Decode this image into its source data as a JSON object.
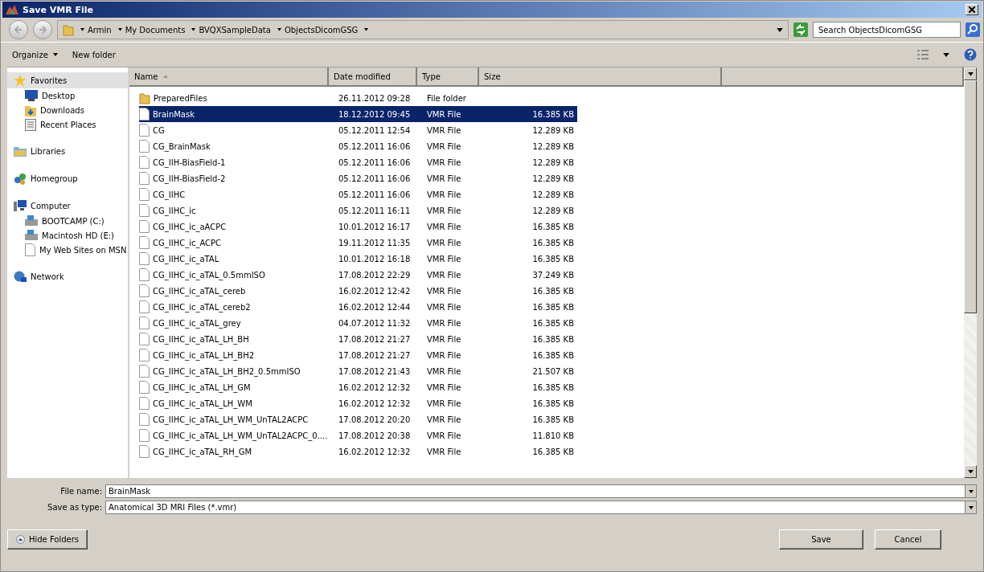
{
  "window": {
    "title": "Save VMR File"
  },
  "address": {
    "crumbs": [
      "Armin",
      "My Documents",
      "BVQXSampleData",
      "ObjectsDicomGSG"
    ],
    "search_placeholder": "Search ObjectsDicomGSG"
  },
  "toolbar": {
    "organize": "Organize",
    "new_folder": "New folder"
  },
  "sidebar": [
    {
      "label": "Favorites",
      "kind": "star",
      "selected": true,
      "children": [
        {
          "label": "Desktop",
          "kind": "desktop",
          "selected": false
        },
        {
          "label": "Downloads",
          "kind": "downloads",
          "selected": false
        },
        {
          "label": "Recent Places",
          "kind": "recent",
          "selected": false
        }
      ]
    },
    {
      "label": "Libraries",
      "kind": "library",
      "selected": false
    },
    {
      "label": "Homegroup",
      "kind": "homegroup",
      "selected": false
    },
    {
      "label": "Computer",
      "kind": "computer",
      "selected": false,
      "children": [
        {
          "label": "BOOTCAMP (C:)",
          "kind": "drive",
          "selected": false
        },
        {
          "label": "Macintosh HD (E:)",
          "kind": "drive",
          "selected": false
        },
        {
          "label": "My Web Sites on MSN",
          "kind": "file",
          "selected": false
        }
      ]
    },
    {
      "label": "Network",
      "kind": "network",
      "selected": false
    }
  ],
  "table": {
    "columns": [
      "Name",
      "Date modified",
      "Type",
      "Size"
    ],
    "rows": [
      {
        "name": "PreparedFiles",
        "date": "26.11.2012 09:28",
        "type": "File folder",
        "size": "",
        "kind": "folder",
        "selected": false
      },
      {
        "name": "BrainMask",
        "date": "18.12.2012 09:45",
        "type": "VMR File",
        "size": "16.385 KB",
        "kind": "file",
        "selected": true
      },
      {
        "name": "CG",
        "date": "05.12.2011 12:54",
        "type": "VMR File",
        "size": "12.289 KB",
        "kind": "file",
        "selected": false
      },
      {
        "name": "CG_BrainMask",
        "date": "05.12.2011 16:06",
        "type": "VMR File",
        "size": "12.289 KB",
        "kind": "file",
        "selected": false
      },
      {
        "name": "CG_IIH-BiasField-1",
        "date": "05.12.2011 16:06",
        "type": "VMR File",
        "size": "12.289 KB",
        "kind": "file",
        "selected": false
      },
      {
        "name": "CG_IIH-BiasField-2",
        "date": "05.12.2011 16:06",
        "type": "VMR File",
        "size": "12.289 KB",
        "kind": "file",
        "selected": false
      },
      {
        "name": "CG_IIHC",
        "date": "05.12.2011 16:06",
        "type": "VMR File",
        "size": "12.289 KB",
        "kind": "file",
        "selected": false
      },
      {
        "name": "CG_IIHC_ic",
        "date": "05.12.2011 16:11",
        "type": "VMR File",
        "size": "12.289 KB",
        "kind": "file",
        "selected": false
      },
      {
        "name": "CG_IIHC_ic_aACPC",
        "date": "10.01.2012 16:17",
        "type": "VMR File",
        "size": "16.385 KB",
        "kind": "file",
        "selected": false
      },
      {
        "name": "CG_IIHC_ic_ACPC",
        "date": "19.11.2012 11:35",
        "type": "VMR File",
        "size": "16.385 KB",
        "kind": "file",
        "selected": false
      },
      {
        "name": "CG_IIHC_ic_aTAL",
        "date": "10.01.2012 16:18",
        "type": "VMR File",
        "size": "16.385 KB",
        "kind": "file",
        "selected": false
      },
      {
        "name": "CG_IIHC_ic_aTAL_0.5mmISO",
        "date": "17.08.2012 22:29",
        "type": "VMR File",
        "size": "37.249 KB",
        "kind": "file",
        "selected": false
      },
      {
        "name": "CG_IIHC_ic_aTAL_cereb",
        "date": "16.02.2012 12:42",
        "type": "VMR File",
        "size": "16.385 KB",
        "kind": "file",
        "selected": false
      },
      {
        "name": "CG_IIHC_ic_aTAL_cereb2",
        "date": "16.02.2012 12:44",
        "type": "VMR File",
        "size": "16.385 KB",
        "kind": "file",
        "selected": false
      },
      {
        "name": "CG_IIHC_ic_aTAL_grey",
        "date": "04.07.2012 11:32",
        "type": "VMR File",
        "size": "16.385 KB",
        "kind": "file",
        "selected": false
      },
      {
        "name": "CG_IIHC_ic_aTAL_LH_BH",
        "date": "17.08.2012 21:27",
        "type": "VMR File",
        "size": "16.385 KB",
        "kind": "file",
        "selected": false
      },
      {
        "name": "CG_IIHC_ic_aTAL_LH_BH2",
        "date": "17.08.2012 21:27",
        "type": "VMR File",
        "size": "16.385 KB",
        "kind": "file",
        "selected": false
      },
      {
        "name": "CG_IIHC_ic_aTAL_LH_BH2_0.5mmISO",
        "date": "17.08.2012 21:43",
        "type": "VMR File",
        "size": "21.507 KB",
        "kind": "file",
        "selected": false
      },
      {
        "name": "CG_IIHC_ic_aTAL_LH_GM",
        "date": "16.02.2012 12:32",
        "type": "VMR File",
        "size": "16.385 KB",
        "kind": "file",
        "selected": false
      },
      {
        "name": "CG_IIHC_ic_aTAL_LH_WM",
        "date": "16.02.2012 12:32",
        "type": "VMR File",
        "size": "16.385 KB",
        "kind": "file",
        "selected": false
      },
      {
        "name": "CG_IIHC_ic_aTAL_LH_WM_UnTAL2ACPC",
        "date": "17.08.2012 20:20",
        "type": "VMR File",
        "size": "16.385 KB",
        "kind": "file",
        "selected": false
      },
      {
        "name": "CG_IIHC_ic_aTAL_LH_WM_UnTAL2ACPC_0....",
        "date": "17.08.2012 20:38",
        "type": "VMR File",
        "size": "11.810 KB",
        "kind": "file",
        "selected": false
      },
      {
        "name": "CG_IIHC_ic_aTAL_RH_GM",
        "date": "16.02.2012 12:32",
        "type": "VMR File",
        "size": "16.385 KB",
        "kind": "file",
        "selected": false
      }
    ]
  },
  "form": {
    "file_name_label": "File name:",
    "file_name": "BrainMask",
    "type_label": "Save as type:",
    "type": "Anatomical 3D MRI Files (*.vmr)"
  },
  "buttons": {
    "hide_folders": "Hide Folders",
    "save": "Save",
    "cancel": "Cancel"
  }
}
